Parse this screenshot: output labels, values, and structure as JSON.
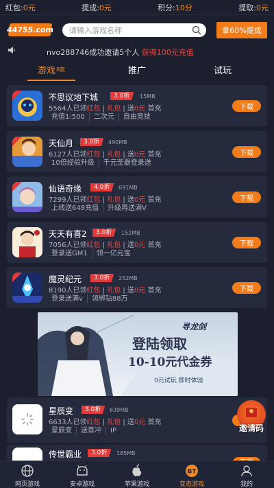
{
  "stats": [
    {
      "label": "红包:",
      "value": "0元"
    },
    {
      "label": "提成:",
      "value": "0元"
    },
    {
      "label": "积分:",
      "value": "10分"
    },
    {
      "label": "提取:",
      "value": "0元"
    }
  ],
  "header": {
    "logo_text": "44755.com",
    "search_placeholder": "请输入游戏名称",
    "promo_label": "拿60%提成"
  },
  "notice": {
    "prefix": "nvo288746成功邀请5个人 ",
    "highlight": "获得100元充值"
  },
  "tabs": [
    {
      "label": "游戏",
      "count": "8款",
      "active": true
    },
    {
      "label": "推广",
      "count": "",
      "active": false
    },
    {
      "label": "试玩",
      "count": "",
      "active": false
    }
  ],
  "games": [
    {
      "name": "不思议地下城",
      "discount": "3.0折",
      "size": "15MB",
      "players": "5564人已领",
      "gift1": "红包",
      "gift2": "礼包",
      "sent": "送",
      "amount": "0元",
      "first": "首充",
      "tags": [
        "充值1:500",
        "二次元",
        "自由竞技"
      ],
      "download": "下载"
    },
    {
      "name": "天仙月",
      "discount": "3.0折",
      "size": "490MB",
      "players": "6127人已领",
      "gift1": "红包",
      "gift2": "礼包",
      "sent": "送",
      "amount": "0元",
      "first": "首充",
      "tags": [
        "10倍经验升级",
        "千元圣器登录送"
      ],
      "download": "下载"
    },
    {
      "name": "仙语奇缘",
      "discount": "4.0折",
      "size": "691MB",
      "players": "7299人已领",
      "gift1": "红包",
      "gift2": "礼包",
      "sent": "送",
      "amount": "0元",
      "first": "首充",
      "tags": [
        "上线送648充值",
        "升级再送满V"
      ],
      "download": "下载"
    },
    {
      "name": "天天有喜2",
      "discount": "3.0折",
      "size": "152MB",
      "players": "7056人已领",
      "gift1": "红包",
      "gift2": "礼包",
      "sent": "送",
      "amount": "0元",
      "first": "首充",
      "tags": [
        "登录送GM1",
        "领一亿元宝"
      ],
      "download": "下载"
    },
    {
      "name": "魔灵纪元",
      "discount": "3.0折",
      "size": "252MB",
      "players": "8190人已领",
      "gift1": "红包",
      "gift2": "礼包",
      "sent": "送",
      "amount": "0元",
      "first": "首充",
      "tags": [
        "登录送满v",
        "领绑钻88万"
      ],
      "download": "下载"
    },
    {
      "name": "星辰变",
      "discount": "3.0折",
      "size": "639MB",
      "players": "6633人已领",
      "gift1": "红包",
      "gift2": "礼包",
      "sent": "送",
      "amount": "0元",
      "first": "首充",
      "tags": [
        "星辰变",
        "送首冲",
        "IP"
      ],
      "download": "下载"
    },
    {
      "name": "传世霸业",
      "discount": "3.0折",
      "size": "185MB",
      "players": "",
      "gift1": "",
      "gift2": "",
      "sent": "",
      "amount": "",
      "first": "",
      "tags": [],
      "download": "下载"
    }
  ],
  "banner": {
    "logo": "寻龙剑",
    "line1": "登陆领取",
    "line2": "10-10元代金券",
    "sub": "0元试玩 即时体验"
  },
  "invite_label": "邀请码",
  "bottom_nav": [
    {
      "label": "网页游戏",
      "icon": "globe-icon",
      "active": false
    },
    {
      "label": "安卓游戏",
      "icon": "android-icon",
      "active": false
    },
    {
      "label": "苹果游戏",
      "icon": "apple-icon",
      "active": false
    },
    {
      "label": "变态游戏",
      "icon": "bt-icon",
      "active": true
    },
    {
      "label": "我的",
      "icon": "user-icon",
      "active": false
    }
  ],
  "colors": {
    "accent": "#f27b1a",
    "background": "#1b1f2e",
    "card": "#252b3d",
    "discount": "#e23b3b",
    "highlight": "#ea4a45"
  }
}
